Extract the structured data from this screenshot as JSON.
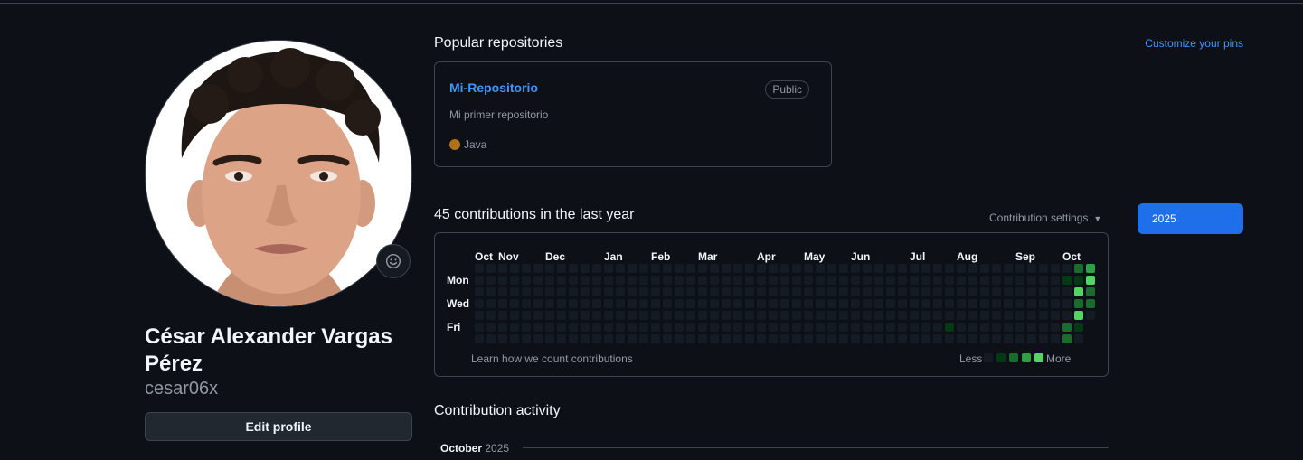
{
  "profile": {
    "full_name": "César Alexander Vargas Pérez",
    "username": "cesar06x",
    "edit_label": "Edit profile"
  },
  "popular": {
    "title": "Popular repositories",
    "customize_label": "Customize your pins",
    "repo": {
      "name": "Mi-Repositorio",
      "visibility": "Public",
      "description": "Mi primer repositorio",
      "language": "Java",
      "language_color": "#b07219"
    }
  },
  "contributions": {
    "title": "45 contributions in the last year",
    "settings_label": "Contribution settings",
    "year": "2025",
    "months": [
      "Oct",
      "Nov",
      "Dec",
      "Jan",
      "Feb",
      "Mar",
      "Apr",
      "May",
      "Jun",
      "Jul",
      "Aug",
      "Sep",
      "Oct"
    ],
    "days": [
      "Mon",
      "Wed",
      "Fri"
    ],
    "learn_label": "Learn how we count contributions",
    "legend_less": "Less",
    "legend_more": "More",
    "level_colors": [
      "#151b23",
      "#033a16",
      "#196c2e",
      "#2ea043",
      "#56d364"
    ],
    "weeks": 53,
    "active_cells": [
      {
        "week": 40,
        "day": 5,
        "level": 1
      },
      {
        "week": 50,
        "day": 5,
        "level": 2
      },
      {
        "week": 50,
        "day": 1,
        "level": 1
      },
      {
        "week": 50,
        "day": 6,
        "level": 2
      },
      {
        "week": 51,
        "day": 0,
        "level": 2
      },
      {
        "week": 51,
        "day": 1,
        "level": 1
      },
      {
        "week": 51,
        "day": 2,
        "level": 4
      },
      {
        "week": 51,
        "day": 3,
        "level": 2
      },
      {
        "week": 51,
        "day": 4,
        "level": 4
      },
      {
        "week": 51,
        "day": 5,
        "level": 1
      },
      {
        "week": 52,
        "day": 0,
        "level": 3
      },
      {
        "week": 52,
        "day": 1,
        "level": 4
      },
      {
        "week": 52,
        "day": 2,
        "level": 2
      },
      {
        "week": 52,
        "day": 3,
        "level": 2
      }
    ]
  },
  "activity": {
    "title": "Contribution activity",
    "month": "October",
    "year": "2025"
  }
}
